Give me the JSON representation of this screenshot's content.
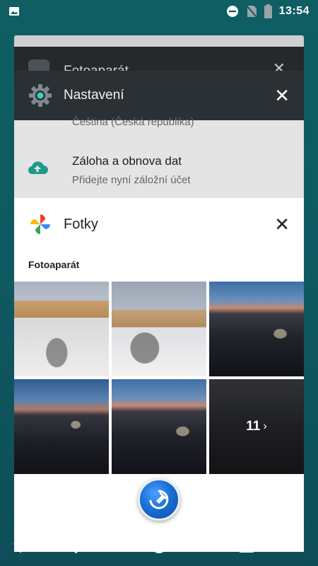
{
  "status_bar": {
    "time": "13:54",
    "icons": [
      "image-icon",
      "dnd-icon",
      "no-sim-icon",
      "battery-icon"
    ]
  },
  "recents": {
    "camera_card": {
      "title": "Fotoaparát",
      "icon": "camera-icon"
    },
    "settings_card": {
      "title": "Nastavení",
      "icon": "gear-icon",
      "partial_row": "Čeština (Česká republika)",
      "row": {
        "icon": "cloud-upload-icon",
        "primary": "Záloha a obnova dat",
        "secondary": "Přidejte nyní záložní účet"
      }
    },
    "photos_card": {
      "title": "Fotky",
      "icon": "pinwheel-icon",
      "section_label": "Fotoaparát",
      "more_count": "11"
    }
  },
  "colors": {
    "wallpaper": "#0e5e63",
    "settings_header": "#2a3034",
    "cloud_icon": "#1e9a8a",
    "fab": "#1a6fd6"
  },
  "nav": [
    "collapse-icon",
    "back-icon",
    "home-icon",
    "recents-icon"
  ]
}
